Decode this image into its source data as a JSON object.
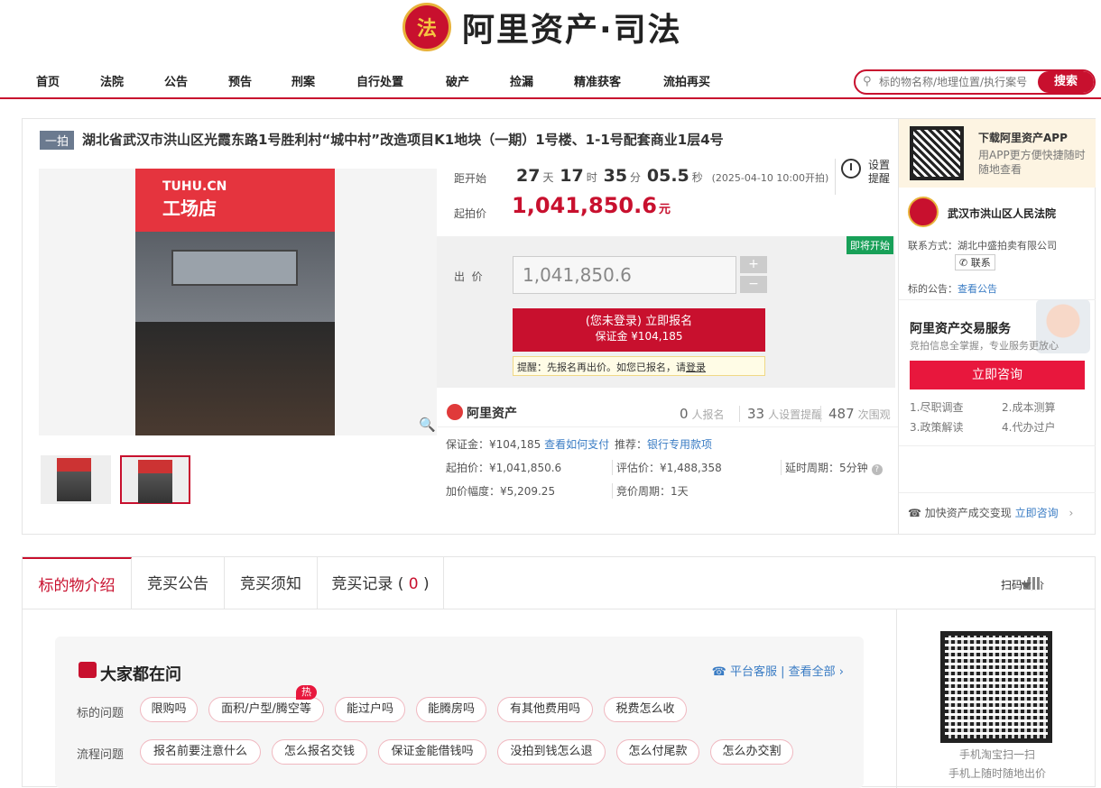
{
  "header": {
    "emblem_label": "法",
    "brand": "阿里资产·司法",
    "nav": [
      "首页",
      "法院",
      "公告",
      "预告",
      "刑案",
      "自行处置",
      "破产",
      "捡漏",
      "精准获客",
      "流拍再买"
    ],
    "search_placeholder": "标的物名称/地理位置/执行案号",
    "search_button": "搜索"
  },
  "item": {
    "tag": "一拍",
    "title": "湖北省武汉市洪山区光霞东路1号胜利村“城中村”改造项目K1地块（一期）1号楼、1-1号配套商业1层4号",
    "photo_sign": "工场店",
    "photo_brand": "TUHU.CN"
  },
  "auction": {
    "countdown_label": "距开始",
    "days": "27",
    "days_unit": "天",
    "hours": "17",
    "hours_unit": "时",
    "minutes": "35",
    "minutes_unit": "分",
    "seconds": "05.5",
    "seconds_unit": "秒",
    "start_note": "(2025-04-10 10:00开拍)",
    "start_price_label": "起拍价",
    "start_price": "1,041,850.6",
    "price_unit": "元",
    "remind_label": "设置提醒",
    "status_badge": "即将开始",
    "bid_label": "出  价",
    "bid_value": "1,041,850.6",
    "signup_line1": "(您未登录) 立即报名",
    "signup_line2": "保证金 ¥104,185",
    "tip_text": "提醒：先报名再出价。如您已报名，请",
    "tip_link": "登录"
  },
  "stats": {
    "brand": "阿里资产",
    "signed_count": "0",
    "signed_label": "人报名",
    "remind_count": "33",
    "remind_label": "人设置提醒",
    "view_count": "487",
    "view_label": "次围观"
  },
  "details": {
    "deposit": "保证金：¥104,185",
    "deposit_link": "查看如何支付",
    "recommend_label": "推荐：",
    "recommend_link": "银行专用款项",
    "start_price": "起拍价：¥1,041,850.6",
    "eval_price": "评估价：¥1,488,358",
    "delay": "延时周期：5分钟",
    "increment": "加价幅度：¥5,209.25",
    "cycle": "竞价周期：1天"
  },
  "side": {
    "app_title": "下载阿里资产APP",
    "app_sub": "用APP更方便快捷随时随地查看",
    "court_name": "武汉市洪山区人民法院",
    "contact_label": "联系方式：湖北中盛拍卖有限公司",
    "contact_button": "联系",
    "notice_label": "标的公告：",
    "notice_link": "查看公告",
    "service_title": "阿里资产交易服务",
    "service_sub": "竞拍信息全掌握，专业服务更放心",
    "consult_button": "立即咨询",
    "services": [
      "1.尽职调查",
      "2.成本测算",
      "3.政策解读",
      "4.代办过户"
    ],
    "accel_text": "加快资产成交变现",
    "accel_link": "立即咨询"
  },
  "tabs": {
    "items": [
      "标的物介绍",
      "竞买公告",
      "竞买须知",
      "竞买记录"
    ],
    "record_count": "0",
    "scan_label": "扫码出价"
  },
  "faq": {
    "title": "大家都在问",
    "service_link": "平台客服",
    "all_link": "查看全部",
    "row1_label": "标的问题",
    "row1": [
      "限购吗",
      "面积/户型/腾空等",
      "能过户吗",
      "能腾房吗",
      "有其他费用吗",
      "税费怎么收"
    ],
    "hot": "热",
    "row2_label": "流程问题",
    "row2": [
      "报名前要注意什么",
      "怎么报名交钱",
      "保证金能借钱吗",
      "没拍到钱怎么退",
      "怎么付尾款",
      "怎么办交割"
    ]
  },
  "qr": {
    "line1": "手机淘宝扫一扫",
    "line2": "手机上随时随地出价"
  },
  "colors": {
    "brand_red": "#c8102e",
    "link_blue": "#3a7cc4",
    "badge_green": "#18a058"
  }
}
